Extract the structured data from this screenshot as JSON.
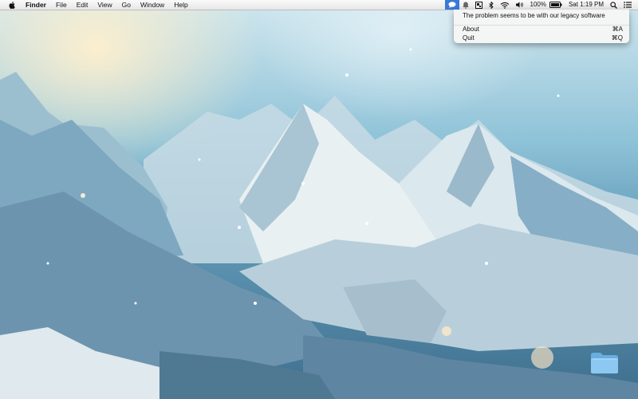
{
  "menubar": {
    "app_name": "Finder",
    "menus": [
      "File",
      "Edit",
      "View",
      "Go",
      "Window",
      "Help"
    ],
    "battery": "100%",
    "clock": "Sat 1:19 PM",
    "status_icons": [
      "chat-bubble-icon",
      "notification-icon",
      "app-status-icon",
      "bluetooth-icon",
      "wifi-icon",
      "volume-icon",
      "battery-icon",
      "spotlight-icon",
      "notification-center-icon"
    ]
  },
  "dropdown": {
    "message": "The problem seems to be with our legacy software",
    "items": [
      {
        "label": "About",
        "shortcut": "⌘A"
      },
      {
        "label": "Quit",
        "shortcut": "⌘Q"
      }
    ]
  },
  "desktop": {
    "wallpaper": "snowy-mountains",
    "icons": [
      "folder-icon"
    ]
  }
}
